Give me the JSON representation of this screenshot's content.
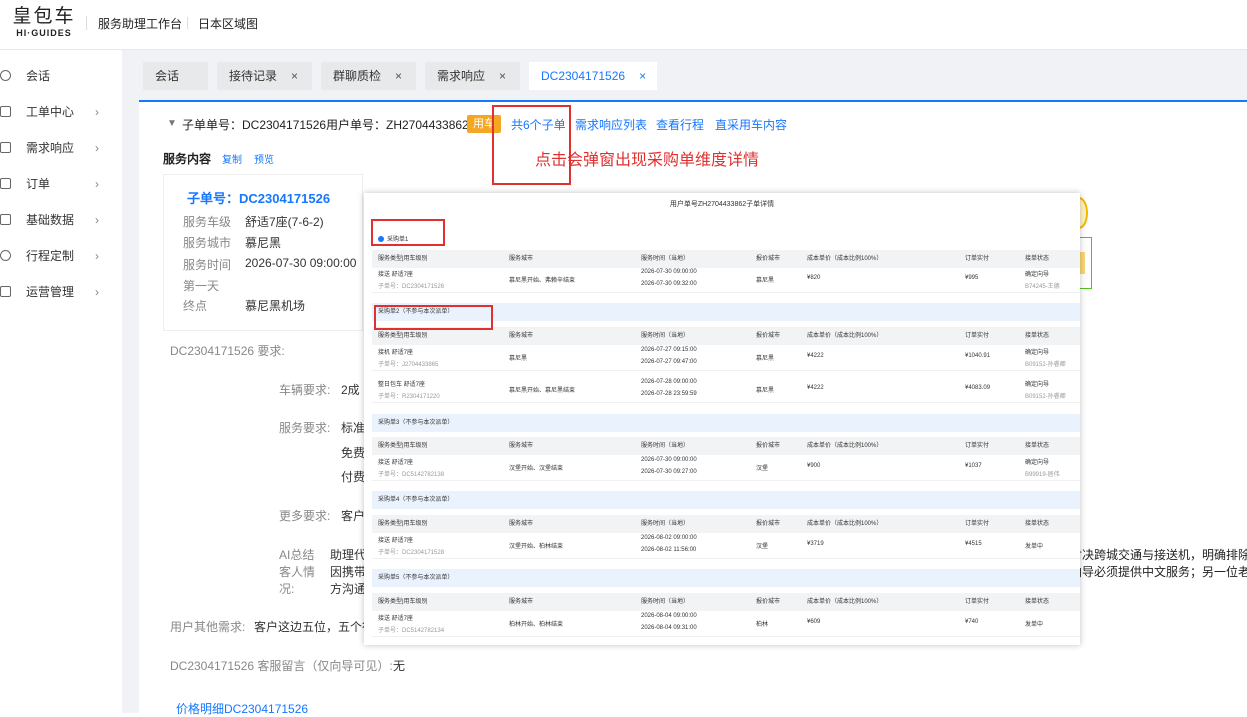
{
  "brand": {
    "cn": "皇包车",
    "en": "HI·GUIDES"
  },
  "topnav": [
    "服务助理工作台",
    "日本区域图"
  ],
  "sidebar": [
    {
      "label": "会话",
      "icon": "chat-icon"
    },
    {
      "label": "工单中心",
      "icon": "ticket-icon"
    },
    {
      "label": "需求响应",
      "icon": "response-icon"
    },
    {
      "label": "订单",
      "icon": "order-icon"
    },
    {
      "label": "基础数据",
      "icon": "data-icon"
    },
    {
      "label": "行程定制",
      "icon": "route-icon"
    },
    {
      "label": "运营管理",
      "icon": "ops-icon"
    }
  ],
  "tabs": [
    {
      "label": "会话",
      "closable": false
    },
    {
      "label": "接待记录",
      "closable": true
    },
    {
      "label": "群聊质检",
      "closable": true
    },
    {
      "label": "需求响应",
      "closable": true
    },
    {
      "label": "DC2304171526",
      "closable": true,
      "active": true
    }
  ],
  "close_glyph": "×",
  "header": {
    "sub_order": "子单单号：DC2304171526",
    "user_order": "用户单号：ZH2704433862",
    "badge": "用车",
    "links": [
      "共6个子单",
      "需求响应列表",
      "查看行程",
      "直采用车内容"
    ]
  },
  "annotation": "点击会弹窗出现采购单维度详情",
  "service": {
    "title": "服务内容",
    "copy": "复制",
    "preview": "预览"
  },
  "card": {
    "title": "子单号：DC2304171526",
    "rows": [
      {
        "k": "服务车级",
        "v": "舒适7座(7-6-2)"
      },
      {
        "k": "服务城市",
        "v": "慕尼黑"
      },
      {
        "k": "服务时间",
        "v": "2026-07-30 09:00:00"
      },
      {
        "k": "第一天",
        "v": ""
      },
      {
        "k": "终点",
        "v": "慕尼黑机场"
      }
    ]
  },
  "requirements": {
    "title": "DC2304171526 要求:",
    "vehicle_label": "车辆要求:",
    "vehicle_value": "2成",
    "service_label": "服务要求:",
    "service_lines": [
      "标准",
      "免费",
      "付费"
    ],
    "more_label": "更多要求:",
    "more_value": "客户",
    "ai_label": "AI总结客人情况:",
    "ai_label_lines": [
      "AI总结",
      "客人情",
      "况:"
    ],
    "ai_lines": [
      "助理代",
      "因携带",
      "方沟通"
    ],
    "ai_right_1": "对决跨城交通与接送机，明确排除司",
    "ai_right_2": "向导必须提供中文服务；另一位老相",
    "user_other_label": "用户其他需求:",
    "user_other_value": "客户这边五位，五个行",
    "cs_note_label": "DC2304171526 客服留言（仅向导可见）:",
    "cs_note_value": "无",
    "price_link": "价格明细DC2304171526"
  },
  "modal": {
    "title": "用户单号ZH2704433862子单详情",
    "headers": [
      "服务类型|用车级别",
      "服务城市",
      "服务时间（当地）",
      "报价城市",
      "成本单价（成本比例100%）",
      "订单实付",
      "接单状态"
    ],
    "sections": [
      {
        "title": "采购单1",
        "primary": true,
        "rows": [
          {
            "type": "接送 舒适7座",
            "sub": "子单号：DC2304171526",
            "city": "慕尼黑开始、弗赖辛结束",
            "t1": "2026-07-30 09:00:00",
            "t2": "2026-07-30 09:32:00",
            "qcity": "慕尼黑",
            "cost": "¥820",
            "pay": "¥995",
            "status": "确定向导",
            "status_sub": "B74245-王德"
          }
        ]
      },
      {
        "title": "采购单2（不参与本次派单）",
        "rows": [
          {
            "type": "接机 舒适7座",
            "sub": "子单号：J2704433865",
            "city": "慕尼黑",
            "t1": "2026-07-27 09:15:00",
            "t2": "2026-07-27 09:47:00",
            "qcity": "慕尼黑",
            "cost": "¥4222",
            "pay": "¥1040.91",
            "status": "确定向导",
            "status_sub": "B09152-孙睿卿"
          },
          {
            "type": "整日包车 舒适7座",
            "sub": "子单号：R2304171220",
            "city": "慕尼黑开始、慕尼黑结束",
            "t1": "2026-07-28 09:00:00",
            "t2": "2026-07-28 23:59:59",
            "qcity": "慕尼黑",
            "cost": "¥4222",
            "pay": "¥4083.09",
            "status": "确定向导",
            "status_sub": "B09152-孙睿卿"
          }
        ]
      },
      {
        "title": "采购单3（不参与本次派单）",
        "rows": [
          {
            "type": "接送 舒适7座",
            "sub": "子单号：DC5142782138",
            "city": "汉堡开始、汉堡结束",
            "t1": "2026-07-30 09:00:00",
            "t2": "2026-07-30 09:27:00",
            "qcity": "汉堡",
            "cost": "¥900",
            "pay": "¥1037",
            "status": "确定向导",
            "status_sub": "B99919-居伟"
          }
        ]
      },
      {
        "title": "采购单4（不参与本次派单）",
        "rows": [
          {
            "type": "接送 舒适7座",
            "sub": "子单号：DC2304171528",
            "city": "汉堡开始、柏林结束",
            "t1": "2026-08-02 09:00:00",
            "t2": "2026-08-02 11:56:00",
            "qcity": "汉堡",
            "cost": "¥3719",
            "pay": "¥4515",
            "status": "发单中",
            "status_sub": ""
          }
        ]
      },
      {
        "title": "采购单5（不参与本次派单）",
        "rows": [
          {
            "type": "接送 舒适7座",
            "sub": "子单号：DC5142782134",
            "city": "柏林开始、柏林结束",
            "t1": "2026-08-04 09:00:00",
            "t2": "2026-08-04 09:31:00",
            "qcity": "柏林",
            "cost": "¥609",
            "pay": "¥740",
            "status": "发单中",
            "status_sub": ""
          }
        ]
      }
    ]
  }
}
